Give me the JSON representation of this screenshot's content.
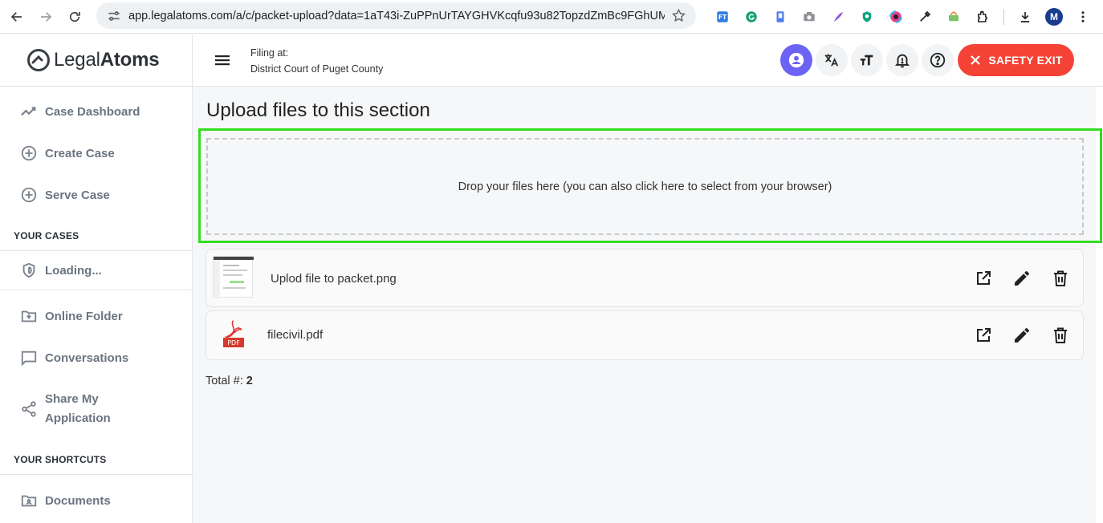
{
  "browser": {
    "url": "app.legalatoms.com/a/c/packet-upload?data=1aT43i-ZuPPnUrTAYGHVKcqfu93u82TopzdZmBc9FGhUMVN...",
    "profile_initial": "M"
  },
  "header": {
    "logo_light": "Legal",
    "logo_bold": "Atoms",
    "filing_label": "Filing at:",
    "filing_court": "District Court of Puget County",
    "safety_exit_label": "SAFETY EXIT"
  },
  "sidebar": {
    "items": [
      {
        "label": "Case Dashboard"
      },
      {
        "label": "Create Case"
      },
      {
        "label": "Serve Case"
      }
    ],
    "section_cases": "YOUR CASES",
    "loading_label": "Loading...",
    "items2": [
      {
        "label": "Online Folder"
      },
      {
        "label": "Conversations"
      },
      {
        "label_line1": "Share My",
        "label_line2": "Application"
      }
    ],
    "section_shortcuts": "YOUR SHORTCUTS",
    "shortcuts": [
      {
        "label": "Documents"
      }
    ]
  },
  "main": {
    "title": "Upload files to this section",
    "drop_text": "Drop your files here (you can also click here to select from your browser)",
    "files": [
      {
        "name": "Uplod file to packet.png"
      },
      {
        "name": "filecivil.pdf",
        "badge": "PDF"
      }
    ],
    "total_label": "Total #:",
    "total_value": "2"
  },
  "colors": {
    "accent": "#6c63f5",
    "danger": "#f44336",
    "highlight": "#33dd22"
  }
}
